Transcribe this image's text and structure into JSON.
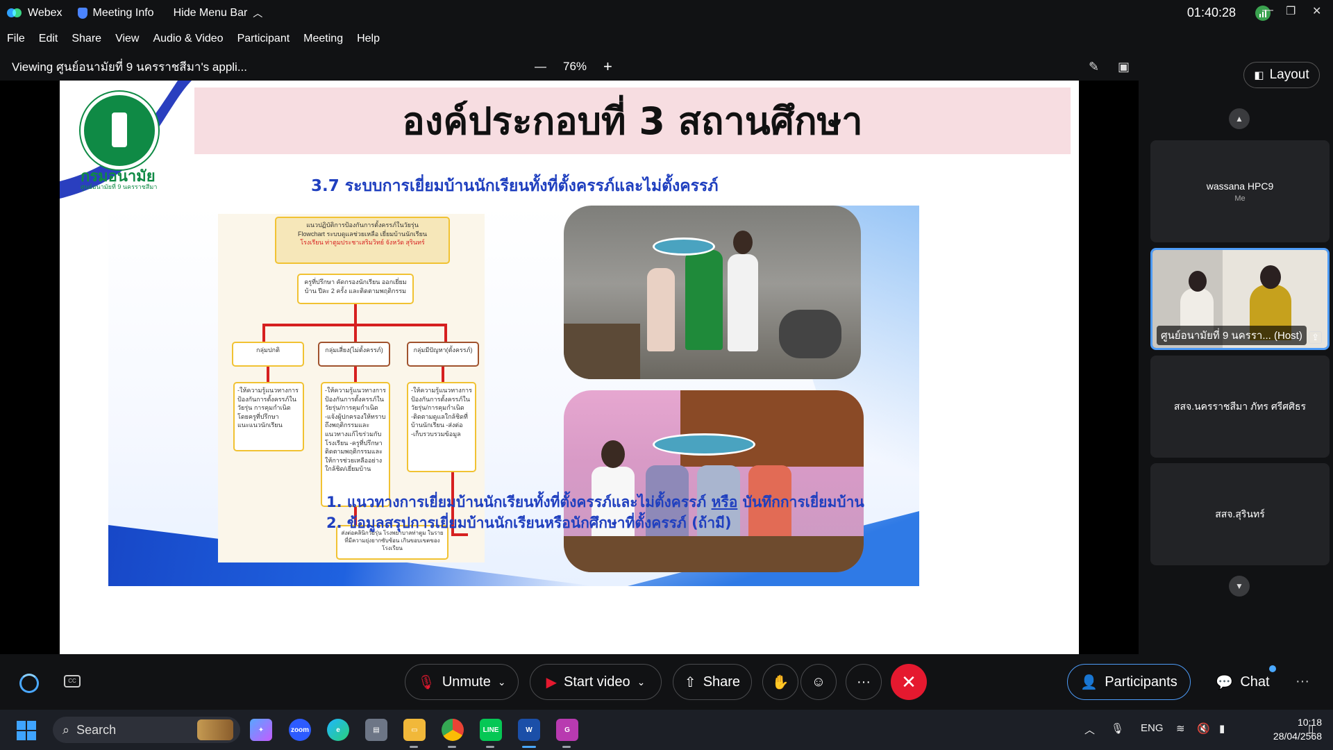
{
  "titlebar": {
    "app_name": "Webex",
    "meeting_info": "Meeting Info",
    "hide_menu_bar": "Hide Menu Bar",
    "clock": "01:40:28"
  },
  "menu": {
    "items": [
      "File",
      "Edit",
      "Share",
      "View",
      "Audio & Video",
      "Participant",
      "Meeting",
      "Help"
    ]
  },
  "viewbar": {
    "viewing": "Viewing ศูนย์อนามัยที่ 9 นครราชสีมา's appli...",
    "zoom": "76%",
    "zoom_out": "—",
    "zoom_in": "+"
  },
  "slide": {
    "title": "องค์ประกอบที่ 3 สถานศึกษา",
    "logo_name": "กรมอนามัย",
    "logo_sub": "ศูนย์อนามัยที่ 9 นครราชสีมา",
    "subtitle": "3.7 ระบบการเยี่ยมบ้านนักเรียนทั้งที่ตั้งครรภ์และไม่ตั้งครรภ์",
    "note1_pre": "1. แนวทางการเยี่ยมบ้านนักเรียนทั้งที่ตั้งครรภ์และไม่ตั้งครรภ์ ",
    "note1_underline": "หรือ",
    "note1_post": " บันทึกการเยี่ยมบ้าน",
    "note2": "2. ข้อมูลสรุปการเยี่ยมบ้านนักเรียนหรือนักศึกษาที่ตั้งครรภ์ (ถ้ามี)",
    "flowchart": {
      "header1": "แนวปฏิบัติการป้องกันการตั้งครรภ์ในวัยรุ่น",
      "header2": "Flowchart ระบบดูแลช่วยเหลือ เยี่ยมบ้านนักเรียน",
      "header3": "โรงเรียน ท่าตูมประชาเสริมวิทย์ จังหวัด สุรินทร์",
      "step1": "ครูที่ปรึกษา คัดกรองนักเรียน ออกเยี่ยมบ้าน ปีละ 2 ครั้ง และติดตามพฤติกรรม",
      "groups": [
        "กลุ่มปกติ",
        "กลุ่มเสี่ยง(ไม่ตั้งครรภ์)",
        "กลุ่มมีปัญหา(ตั้งครรภ์)"
      ],
      "details": [
        "-ให้ความรู้แนวทางการป้องกันการตั้งครรภ์ในวัยรุ่น การคุมกำเนิดโดยครูที่ปรึกษาแนะแนวนักเรียน",
        "-ให้ความรู้แนวทางการป้องกันการตั้งครรภ์ในวัยรุ่น/การคุมกำเนิด -แจ้งผู้ปกครองให้ทราบถึงพฤติกรรมและแนวทางแก้ไขร่วมกับโรงเรียน -ครูที่ปรึกษาติดตามพฤติกรรมและให้การช่วยเหลืออย่างใกล้ชิด/เยี่ยมบ้าน",
        "-ให้ความรู้แนวทางการป้องกันการตั้งครรภ์ในวัยรุ่น/การคุมกำเนิด -ติดตามดูแลใกล้ชิดที่บ้านนักเรียน -ส่งต่อ -เก็บรวบรวมข้อมูล"
      ],
      "final": "ส่งต่อคลินิกวัยรุ่น โรงพยาบาลท่าตูม ในรายที่มีความยุ่งยากซับซ้อน เกินขอบเขตของโรงเรียน"
    }
  },
  "side": {
    "layout_label": "Layout",
    "participants": [
      {
        "name": "wassana HPC9",
        "sub": "Me",
        "video": false
      },
      {
        "name": "ศูนย์อนามัยที่ 9 นครรา... (Host)",
        "sub": "",
        "video": true
      },
      {
        "name": "สสจ.นครราชสีมา ภัทร ศรีศศิธร",
        "sub": "",
        "video": false
      },
      {
        "name": "สสจ.สุรินทร์",
        "sub": "",
        "video": false
      }
    ]
  },
  "controls": {
    "unmute": "Unmute",
    "start_video": "Start video",
    "share": "Share",
    "more": "···",
    "participants": "Participants",
    "chat": "Chat"
  },
  "taskbar": {
    "search_placeholder": "Search",
    "lang": "ENG",
    "time": "10:18",
    "date": "28/04/2568"
  },
  "colors": {
    "accent_blue": "#4d9bf7",
    "end_red": "#e5192f",
    "slide_title_band": "#f7dde1",
    "slide_blue_text": "#1f3fbf",
    "moph_green": "#0f8a45"
  }
}
